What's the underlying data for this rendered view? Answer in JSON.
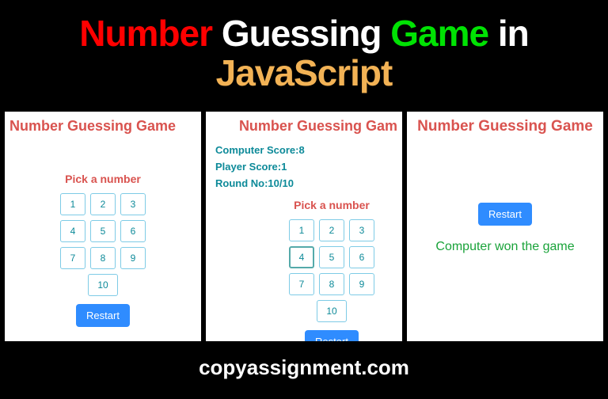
{
  "hero": {
    "w1": "Number",
    "w2": "Guessing",
    "w3": "Game",
    "w4": "in",
    "w5": "JavaScript"
  },
  "panel1": {
    "title": "Number Guessing Game",
    "pick": "Pick a number",
    "buttons": [
      "1",
      "2",
      "3",
      "4",
      "5",
      "6",
      "7",
      "8",
      "9",
      "10"
    ],
    "restart": "Restart"
  },
  "panel2": {
    "title": "Number Guessing Gam",
    "scores": {
      "computer_label": "Computer Score:",
      "computer_value": "8",
      "player_label": "Player Score:",
      "player_value": "1",
      "round_label": "Round No:",
      "round_value": "10/10"
    },
    "pick": "Pick a number",
    "buttons": [
      "1",
      "2",
      "3",
      "4",
      "5",
      "6",
      "7",
      "8",
      "9",
      "10"
    ],
    "restart": "Restart",
    "focused_index": 3
  },
  "panel3": {
    "title": "Number Guessing Game",
    "restart": "Restart",
    "result": "Computer won the game"
  },
  "footer": "copyassignment.com"
}
